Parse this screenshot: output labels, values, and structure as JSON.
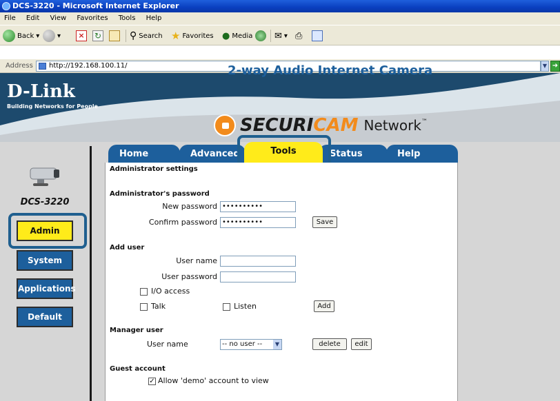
{
  "window": {
    "title": "DCS-3220 - Microsoft Internet Explorer"
  },
  "menu": [
    "File",
    "Edit",
    "View",
    "Favorites",
    "Tools",
    "Help"
  ],
  "toolbar": {
    "back_label": "Back",
    "search_label": "Search",
    "favorites_label": "Favorites",
    "media_label": "Media"
  },
  "address": {
    "label": "Address",
    "url": "http://192.168.100.11/"
  },
  "header": {
    "logo": "D-Link",
    "tagline": "Building Networks for People",
    "brand_securi": "SECURI",
    "brand_cam": "CAM",
    "brand_network": "Network",
    "trademark": "™",
    "subtitle": "2-way Audio Internet Camera"
  },
  "sidebar": {
    "model": "DCS-3220",
    "buttons": [
      "Admin",
      "System",
      "Applications",
      "Default"
    ],
    "active": "Admin"
  },
  "tabs": {
    "items": [
      "Home",
      "Advanced",
      "Tools",
      "Status",
      "Help"
    ],
    "active": "Tools"
  },
  "admin": {
    "section_title": "Administrator settings",
    "password_title": "Administrator's password",
    "new_password_label": "New password",
    "new_password_value": "••••••••••",
    "confirm_password_label": "Confirm password",
    "confirm_password_value": "••••••••••",
    "save_label": "Save"
  },
  "add_user": {
    "title": "Add user",
    "user_name_label": "User name",
    "user_password_label": "User password",
    "io_access_label": "I/O access",
    "talk_label": "Talk",
    "listen_label": "Listen",
    "add_label": "Add"
  },
  "manager": {
    "title": "Manager user",
    "user_name_label": "User name",
    "select_value": "-- no user --",
    "delete_label": "delete",
    "edit_label": "edit"
  },
  "guest": {
    "title": "Guest account",
    "demo_label": "Allow 'demo' account to view",
    "demo_checked": true
  },
  "colors": {
    "accent_blue": "#1d5f9c",
    "active_yellow": "#ffeb1a",
    "highlight": "#1f5f8f",
    "brand_orange": "#f28b1c"
  }
}
